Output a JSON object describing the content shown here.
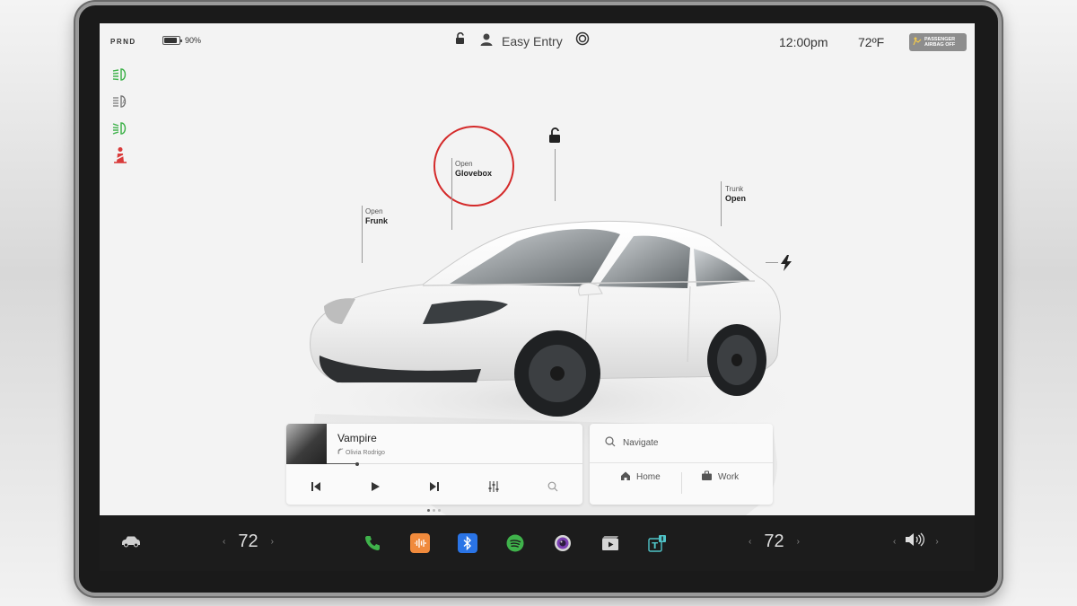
{
  "status_bar": {
    "gear": "PRND",
    "battery_percent_label": "90%",
    "battery_level": 0.9,
    "easy_entry_label": "Easy Entry",
    "time": "12:00pm",
    "temperature": "72ºF",
    "airbag": {
      "line1": "PASSENGER",
      "line2": "AIRBAG OFF"
    }
  },
  "indicators": [
    {
      "icon": "headlights-icon",
      "color": "#3fb24b"
    },
    {
      "icon": "auto-highbeam-icon",
      "color": "#777777"
    },
    {
      "icon": "parking-lights-icon",
      "color": "#3fb24b"
    },
    {
      "icon": "seatbelt-warning-icon",
      "color": "#d93a3a"
    }
  ],
  "car": {
    "frunk": {
      "status": "Open",
      "label": "Frunk"
    },
    "glovebox": {
      "status": "Open",
      "label": "Glovebox"
    },
    "trunk": {
      "label": "Trunk",
      "status": "Open"
    }
  },
  "media": {
    "song": "Vampire",
    "artist": "Olivia Rodrigo",
    "progress": 0.12
  },
  "navigation": {
    "placeholder": "Navigate",
    "home_label": "Home",
    "work_label": "Work"
  },
  "dock": {
    "driver_temp": "72",
    "passenger_temp": "72",
    "apps": [
      "phone-icon",
      "voice-memo-icon",
      "bluetooth-icon",
      "spotify-icon",
      "camera-icon",
      "theater-icon",
      "toybox-icon"
    ]
  },
  "colors": {
    "accent_green": "#3fb24b",
    "warning_red": "#d93a3a",
    "callout_ring": "#d42a2a"
  }
}
